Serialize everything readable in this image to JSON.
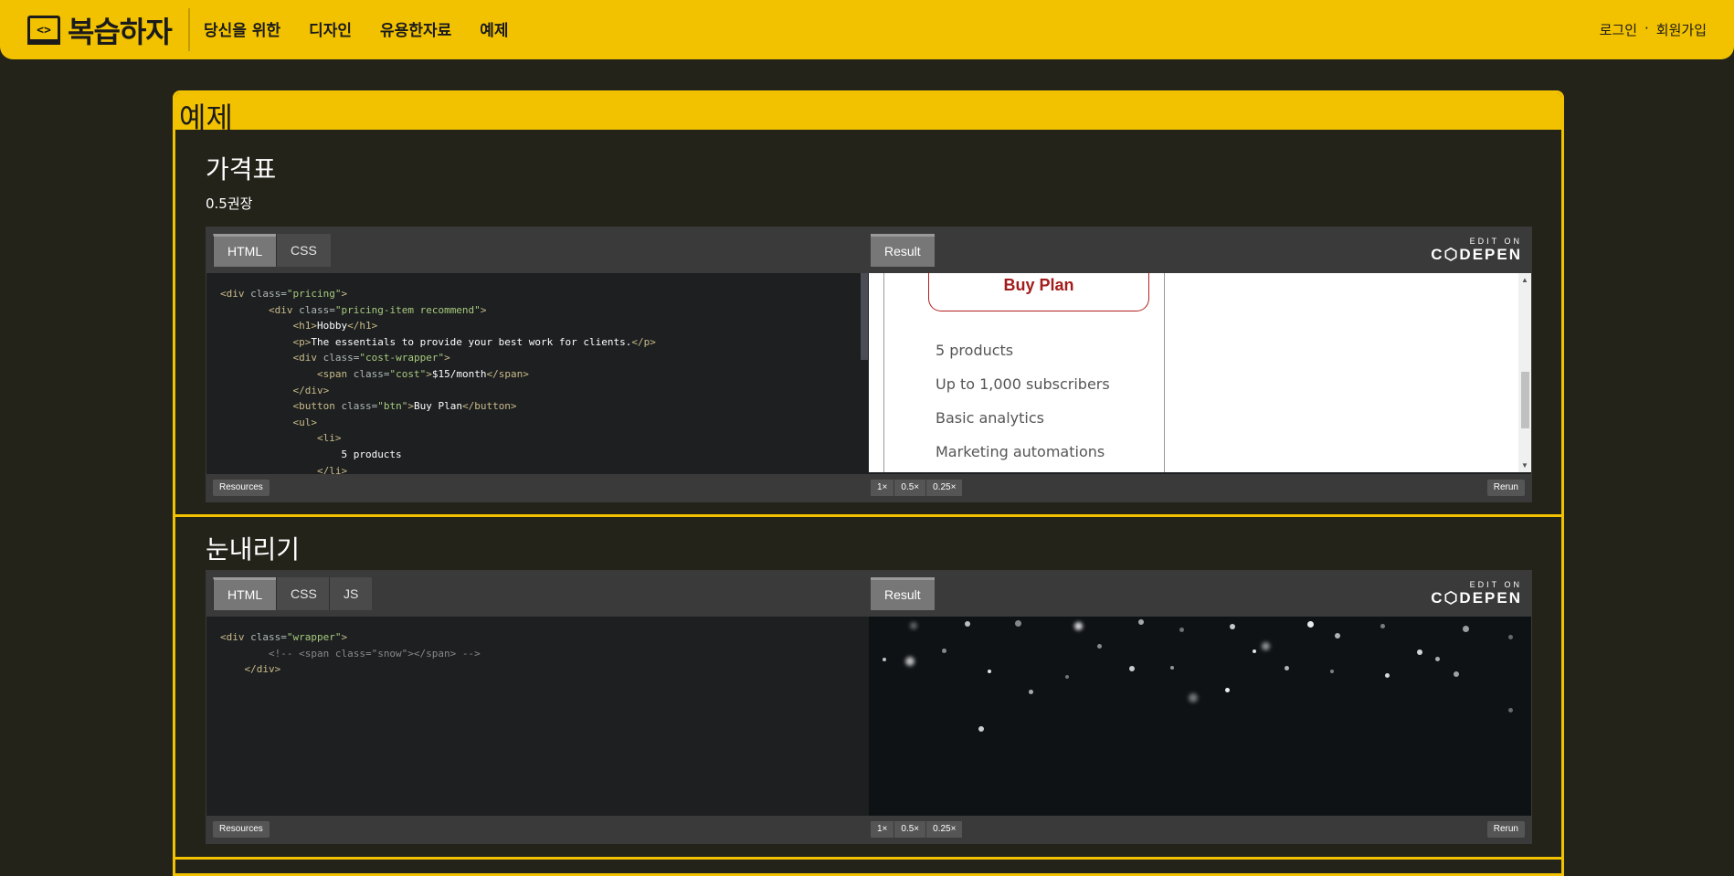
{
  "header": {
    "logo_glyph": "<>",
    "logo_text": "복습하자",
    "nav": [
      "당신을 위한",
      "디자인",
      "유용한자료",
      "예제"
    ],
    "login": "로그인",
    "separator": "·",
    "signup": "회원가입"
  },
  "card": {
    "title": "예제",
    "sections": [
      {
        "title": "가격표",
        "subtitle": "0.5권장",
        "tabs": [
          "HTML",
          "CSS"
        ],
        "result_tab": "Result",
        "editon_small": "EDIT ON",
        "editon_big": "C⬡DEPEN",
        "result": {
          "button": "Buy Plan",
          "features": [
            "5 products",
            "Up to 1,000 subscribers",
            "Basic analytics",
            "Marketing automations"
          ]
        },
        "footer": {
          "resources": "Resources",
          "zoom": [
            "1×",
            "0.5×",
            "0.25×"
          ],
          "rerun": "Rerun"
        }
      },
      {
        "title": "눈내리기",
        "tabs": [
          "HTML",
          "CSS",
          "JS"
        ],
        "result_tab": "Result",
        "editon_small": "EDIT ON",
        "editon_big": "C⬡DEPEN",
        "footer": {
          "resources": "Resources",
          "zoom": [
            "1×",
            "0.5×",
            "0.25×"
          ],
          "rerun": "Rerun"
        }
      }
    ]
  },
  "colors": {
    "accent": "#f2c200",
    "background": "#23231a",
    "buy": "#a31c1c"
  }
}
